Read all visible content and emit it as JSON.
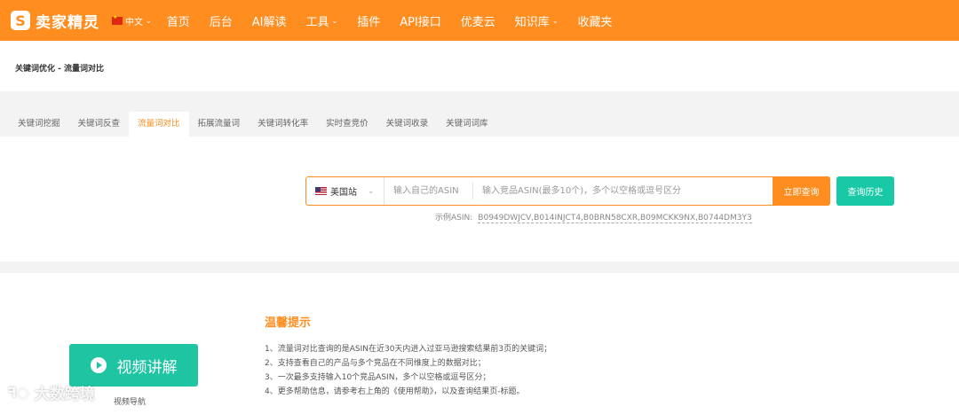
{
  "header": {
    "logo_mark": "S",
    "logo_text": "卖家精灵",
    "language": "中文",
    "nav": [
      {
        "label": "首页",
        "dropdown": false
      },
      {
        "label": "后台",
        "dropdown": false
      },
      {
        "label": "AI解读",
        "dropdown": false
      },
      {
        "label": "工具",
        "dropdown": true
      },
      {
        "label": "插件",
        "dropdown": false
      },
      {
        "label": "API接口",
        "dropdown": false
      },
      {
        "label": "优麦云",
        "dropdown": false
      },
      {
        "label": "知识库",
        "dropdown": true
      },
      {
        "label": "收藏夹",
        "dropdown": false
      }
    ]
  },
  "breadcrumb": "关键词优化 - 流量词对比",
  "tabs": [
    "关键词挖掘",
    "关键词反查",
    "流量词对比",
    "拓展流量词",
    "关键词转化率",
    "实时查竞价",
    "关键词收录",
    "关键词词库"
  ],
  "active_tab": "流量词对比",
  "search": {
    "site": "美国站",
    "own_asin_placeholder": "输入自己的ASIN",
    "competitor_placeholder": "输入竞品ASIN(最多10个)，多个以空格或逗号区分",
    "query_button": "立即查询",
    "history_button": "查询历史",
    "example_label": "示例ASIN:",
    "example_asins": "B0949DWJCV,B014INJCT4,B0BRN58CXR,B09MCKK9NX,B0744DM3Y3"
  },
  "tips": {
    "video_button": "视频讲解",
    "video_nav": "视频导航",
    "title": "温馨提示",
    "items": [
      "1、流量词对比查询的是ASIN在近30天内进入过亚马逊搜索结果前3页的关键词；",
      "2、支持查看自己的产品与多个竞品在不同维度上的数据对比；",
      "3、一次最多支持输入10个竞品ASIN，多个以空格或逗号区分；",
      "4、更多帮助信息，请参考右上角的《使用帮助》，以及查询结果页-标题。"
    ]
  },
  "watermark": "大数跨境",
  "colors": {
    "brand": "#ff8d1f",
    "accent": "#19c9a6"
  }
}
